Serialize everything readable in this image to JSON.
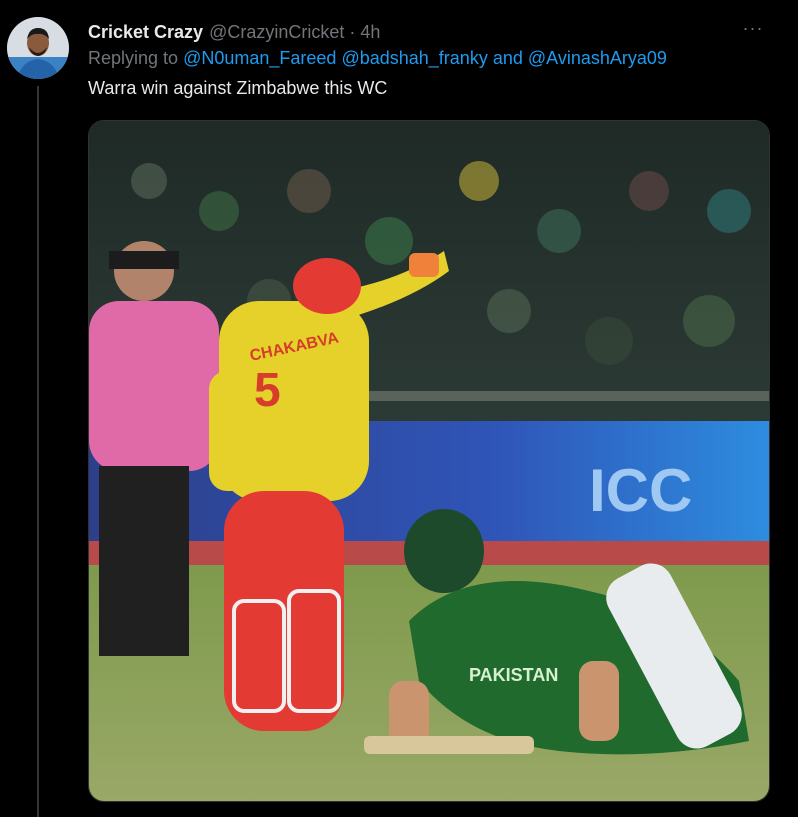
{
  "tweet": {
    "author": {
      "display_name": "Cricket Crazy",
      "handle": "@CrazyinCricket",
      "avatar_icon": "profile-avatar"
    },
    "separator": "·",
    "time": "4h",
    "more_icon": "more-horizontal-icon",
    "more_label": "···",
    "reply": {
      "prefix": "Replying to",
      "mention_1": "@N0uman_Fareed",
      "mention_2": "@badshah_franky",
      "conjunction": "and",
      "mention_3": "@AvinashArya09"
    },
    "text": "Warra win against Zimbabwe this WC",
    "media": {
      "description_icon": "cricket-photo",
      "jersey_name": "CHAKABVA",
      "jersey_number": "5",
      "pakistan_shirt_text": "PAKISTAN",
      "board_text": "ICC"
    }
  },
  "colors": {
    "background": "#000000",
    "text": "#e7e9ea",
    "secondary": "#71767b",
    "link": "#1d9bf0",
    "divider": "#333639"
  }
}
